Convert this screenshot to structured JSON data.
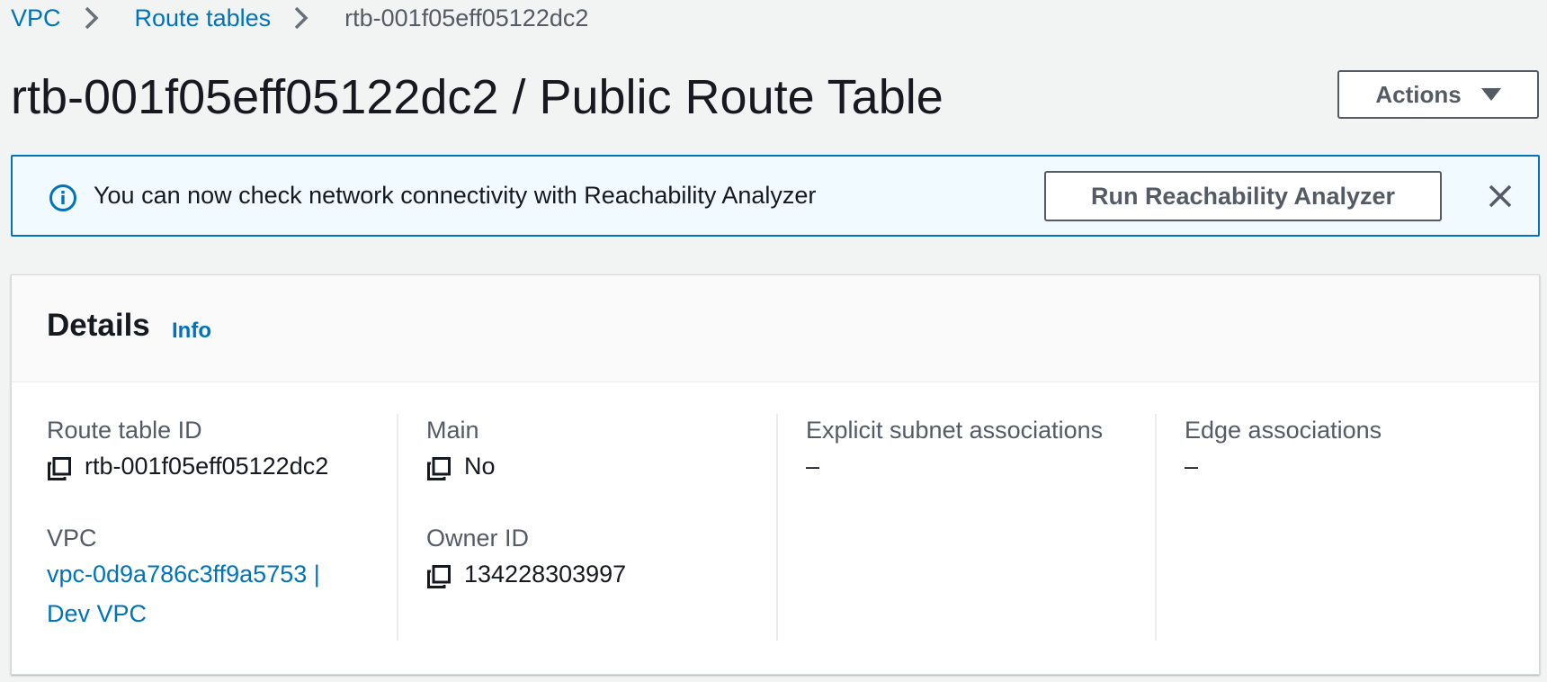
{
  "breadcrumb": {
    "items": [
      "VPC",
      "Route tables"
    ],
    "current": "rtb-001f05eff05122dc2"
  },
  "header": {
    "title": "rtb-001f05eff05122dc2 / Public Route Table",
    "actions_label": "Actions"
  },
  "banner": {
    "message": "You can now check network connectivity with Reachability Analyzer",
    "button_label": "Run Reachability Analyzer"
  },
  "details": {
    "title": "Details",
    "info_link": "Info",
    "route_table_id_label": "Route table ID",
    "route_table_id": "rtb-001f05eff05122dc2",
    "vpc_label": "VPC",
    "vpc_value_line1": "vpc-0d9a786c3ff9a5753 |",
    "vpc_value_line2": "Dev VPC",
    "main_label": "Main",
    "main_value": "No",
    "owner_id_label": "Owner ID",
    "owner_id": "134228303997",
    "explicit_subnet_label": "Explicit subnet associations",
    "explicit_subnet_value": "–",
    "edge_label": "Edge associations",
    "edge_value": "–"
  },
  "colors": {
    "link": "#0073bb",
    "banner_bg": "#f1faff",
    "banner_border": "#0073bb",
    "page_bg": "#f2f3f3",
    "text": "#16191f",
    "muted": "#545b64"
  },
  "icons": [
    "chevron-right-icon",
    "caret-down-icon",
    "info-icon",
    "close-icon",
    "copy-icon"
  ]
}
